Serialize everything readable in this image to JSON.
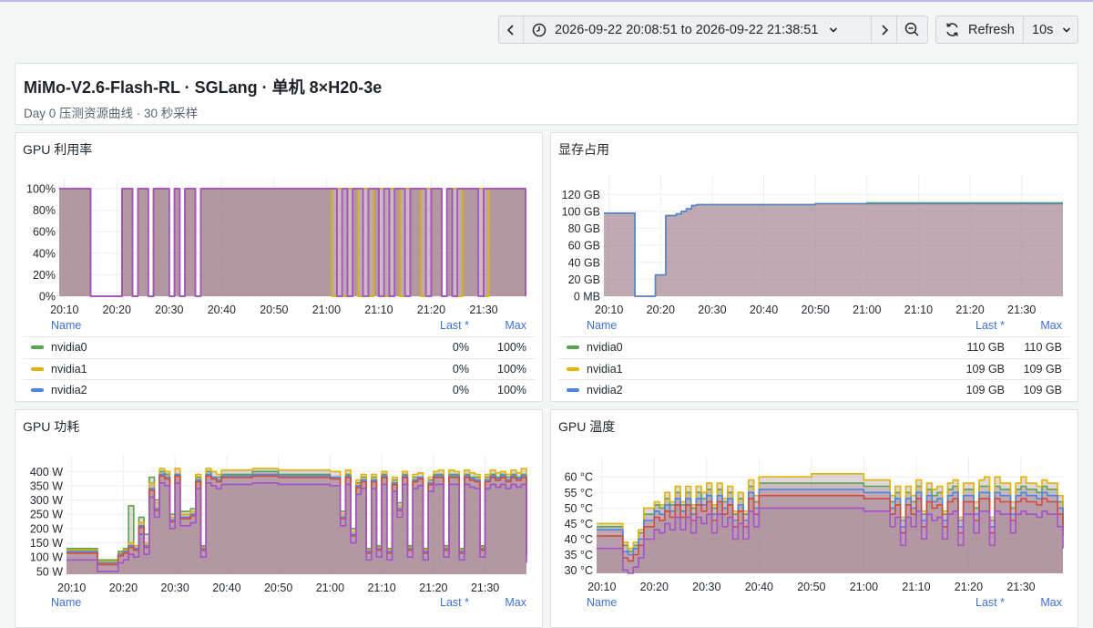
{
  "toolbar": {
    "time_range": "2026-09-22 20:08:51 to 2026-09-22 21:38:51",
    "refresh_label": "Refresh",
    "interval": "10s"
  },
  "header": {
    "title": "MiMo-V2.6-Flash-RL · SGLang · 单机 8×H20-3e",
    "subtitle": "Day 0 压测资源曲线 · 30 秒采样"
  },
  "colors": {
    "nvidia0": "#56a64b",
    "nvidia1": "#e0b400",
    "nvidia2": "#4d84e1",
    "red": "#d44a3a",
    "purple": "#a352cc",
    "fill": "#a88a94"
  },
  "panels": {
    "gpu_util": {
      "title": "GPU 利用率",
      "legend": {
        "name_header": "Name",
        "last_header": "Last *",
        "max_header": "Max",
        "rows": [
          {
            "name": "nvidia0",
            "last": "0%",
            "max": "100%"
          },
          {
            "name": "nvidia1",
            "last": "0%",
            "max": "100%"
          },
          {
            "name": "nvidia2",
            "last": "0%",
            "max": "100%"
          }
        ]
      }
    },
    "mem": {
      "title": "显存占用",
      "legend": {
        "name_header": "Name",
        "last_header": "Last *",
        "max_header": "Max",
        "rows": [
          {
            "name": "nvidia0",
            "last": "110 GB",
            "max": "110 GB"
          },
          {
            "name": "nvidia1",
            "last": "109 GB",
            "max": "109 GB"
          },
          {
            "name": "nvidia2",
            "last": "109 GB",
            "max": "109 GB"
          }
        ]
      }
    },
    "power": {
      "title": "GPU 功耗",
      "legend": {
        "name_header": "Name",
        "last_header": "Last *",
        "max_header": "Max"
      }
    },
    "temp": {
      "title": "GPU 温度",
      "legend": {
        "name_header": "Name",
        "last_header": "Last *",
        "max_header": "Max"
      }
    }
  },
  "chart_data": [
    {
      "id": "gpu_util",
      "type": "line",
      "title": "GPU 利用率",
      "x_ticks": [
        "20:10",
        "20:20",
        "20:30",
        "20:40",
        "20:50",
        "21:00",
        "21:10",
        "21:20",
        "21:30"
      ],
      "y_ticks": [
        "0%",
        "20%",
        "40%",
        "60%",
        "80%",
        "100%"
      ],
      "ylim": [
        0,
        100
      ],
      "x": [
        "20:09",
        "20:14",
        "20:15",
        "20:19",
        "20:20",
        "20:21",
        "20:22",
        "20:23",
        "20:24",
        "20:25",
        "20:26",
        "20:27",
        "20:28",
        "20:29",
        "20:30",
        "20:31",
        "20:32",
        "20:33",
        "20:34",
        "20:35",
        "20:36",
        "20:37",
        "20:38",
        "20:39",
        "21:00",
        "21:01",
        "21:02",
        "21:03",
        "21:04",
        "21:05",
        "21:06",
        "21:07",
        "21:08",
        "21:09",
        "21:10",
        "21:11",
        "21:12",
        "21:13",
        "21:14",
        "21:15",
        "21:16",
        "21:17",
        "21:18",
        "21:19",
        "21:20",
        "21:21",
        "21:22",
        "21:23",
        "21:24",
        "21:25",
        "21:26",
        "21:27",
        "21:28",
        "21:29",
        "21:30",
        "21:31",
        "21:32",
        "21:33",
        "21:34",
        "21:35",
        "21:36",
        "21:37",
        "21:38"
      ],
      "series": [
        {
          "name": "nvidia0",
          "values": [
            100,
            100,
            0,
            0,
            0,
            100,
            100,
            0,
            100,
            100,
            0,
            100,
            100,
            100,
            0,
            100,
            0,
            100,
            100,
            0,
            100,
            100,
            100,
            100,
            100,
            0,
            100,
            0,
            100,
            100,
            0,
            100,
            0,
            100,
            100,
            0,
            100,
            100,
            0,
            100,
            100,
            100,
            0,
            100,
            100,
            100,
            0,
            100,
            100,
            0,
            100,
            100,
            100,
            100,
            0,
            100,
            100,
            100,
            100,
            100,
            100,
            100,
            0
          ]
        },
        {
          "name": "nvidia1",
          "values": [
            100,
            100,
            0,
            0,
            0,
            100,
            100,
            0,
            100,
            100,
            0,
            100,
            100,
            100,
            0,
            100,
            0,
            100,
            100,
            0,
            100,
            100,
            100,
            100,
            100,
            0,
            100,
            0,
            100,
            100,
            0,
            100,
            0,
            100,
            100,
            0,
            100,
            100,
            0,
            100,
            100,
            100,
            0,
            100,
            100,
            100,
            0,
            100,
            100,
            0,
            100,
            100,
            100,
            100,
            0,
            100,
            100,
            100,
            100,
            100,
            100,
            100,
            0
          ]
        },
        {
          "name": "nvidia2",
          "values": [
            100,
            100,
            0,
            0,
            0,
            100,
            100,
            0,
            100,
            100,
            0,
            100,
            100,
            100,
            0,
            100,
            0,
            100,
            100,
            0,
            100,
            100,
            100,
            100,
            100,
            100,
            0,
            100,
            0,
            100,
            100,
            0,
            100,
            100,
            0,
            100,
            0,
            100,
            100,
            0,
            100,
            100,
            100,
            0,
            100,
            100,
            0,
            100,
            0,
            100,
            100,
            100,
            100,
            0,
            100,
            100,
            100,
            100,
            100,
            100,
            100,
            100,
            0
          ]
        }
      ]
    },
    {
      "id": "mem",
      "type": "line",
      "title": "显存占用",
      "x_ticks": [
        "20:10",
        "20:20",
        "20:30",
        "20:40",
        "20:50",
        "21:00",
        "21:10",
        "21:20",
        "21:30"
      ],
      "y_ticks": [
        "0 MB",
        "20 GB",
        "40 GB",
        "60 GB",
        "80 GB",
        "100 GB",
        "120 GB"
      ],
      "ylim": [
        0,
        130
      ],
      "x": [
        "20:09",
        "20:14",
        "20:15",
        "20:18",
        "20:19",
        "20:20",
        "20:21",
        "20:22",
        "20:23",
        "20:24",
        "20:25",
        "20:26",
        "20:27",
        "20:30",
        "20:40",
        "20:50",
        "21:00",
        "21:10",
        "21:20",
        "21:30",
        "21:38"
      ],
      "series": [
        {
          "name": "nvidia0",
          "values": [
            98,
            98,
            0,
            0,
            25,
            25,
            95,
            95,
            97,
            100,
            103,
            107,
            108,
            108,
            108,
            109,
            110,
            110,
            110,
            110,
            110
          ]
        },
        {
          "name": "nvidia1",
          "values": [
            98,
            98,
            0,
            0,
            25,
            25,
            95,
            95,
            97,
            100,
            103,
            107,
            108,
            108,
            108,
            109,
            109,
            109,
            109,
            109,
            109
          ]
        },
        {
          "name": "nvidia2",
          "values": [
            98,
            98,
            0,
            0,
            25,
            25,
            95,
            95,
            97,
            100,
            103,
            107,
            108,
            108,
            108,
            109,
            109,
            109,
            109,
            109,
            109
          ]
        }
      ]
    },
    {
      "id": "power",
      "type": "line",
      "title": "GPU 功耗",
      "x_ticks": [
        "20:10",
        "20:20",
        "20:30",
        "20:40",
        "20:50",
        "21:00",
        "21:10",
        "21:20",
        "21:30"
      ],
      "y_ticks": [
        "50 W",
        "100 W",
        "150 W",
        "200 W",
        "250 W",
        "300 W",
        "350 W",
        "400 W"
      ],
      "ylim": [
        40,
        420
      ],
      "x": [
        "20:09",
        "20:14",
        "20:15",
        "20:18",
        "20:19",
        "20:20",
        "20:21",
        "20:22",
        "20:23",
        "20:24",
        "20:25",
        "20:26",
        "20:27",
        "20:28",
        "20:29",
        "20:30",
        "20:31",
        "20:32",
        "20:33",
        "20:34",
        "20:35",
        "20:36",
        "20:37",
        "20:38",
        "20:39",
        "20:40",
        "20:45",
        "20:50",
        "20:55",
        "21:00",
        "21:02",
        "21:03",
        "21:04",
        "21:05",
        "21:06",
        "21:07",
        "21:08",
        "21:09",
        "21:10",
        "21:11",
        "21:12",
        "21:13",
        "21:14",
        "21:15",
        "21:16",
        "21:17",
        "21:18",
        "21:19",
        "21:20",
        "21:21",
        "21:22",
        "21:23",
        "21:24",
        "21:25",
        "21:26",
        "21:27",
        "21:28",
        "21:29",
        "21:30",
        "21:31",
        "21:32",
        "21:33",
        "21:34",
        "21:35",
        "21:36",
        "21:37",
        "21:38"
      ],
      "series": [
        {
          "name": "nvidia0",
          "values": [
            130,
            130,
            90,
            90,
            120,
            130,
            280,
            140,
            240,
            180,
            380,
            300,
            400,
            390,
            250,
            390,
            260,
            260,
            270,
            380,
            140,
            400,
            380,
            380,
            390,
            390,
            400,
            390,
            390,
            380,
            260,
            390,
            200,
            360,
            380,
            130,
            380,
            140,
            390,
            130,
            370,
            290,
            390,
            140,
            380,
            380,
            130,
            370,
            390,
            390,
            140,
            390,
            390,
            130,
            390,
            380,
            380,
            140,
            380,
            390,
            380,
            390,
            380,
            390,
            380,
            390,
            120
          ]
        },
        {
          "name": "nvidia1",
          "values": [
            125,
            125,
            85,
            85,
            115,
            125,
            150,
            140,
            220,
            150,
            360,
            290,
            410,
            400,
            240,
            410,
            250,
            250,
            260,
            390,
            135,
            410,
            400,
            390,
            405,
            405,
            410,
            405,
            405,
            400,
            250,
            405,
            190,
            370,
            390,
            125,
            390,
            135,
            400,
            125,
            380,
            280,
            400,
            135,
            390,
            395,
            125,
            380,
            400,
            405,
            135,
            405,
            400,
            125,
            405,
            395,
            390,
            135,
            390,
            405,
            395,
            400,
            390,
            405,
            395,
            410,
            115
          ]
        },
        {
          "name": "nvidia2",
          "values": [
            120,
            120,
            80,
            80,
            110,
            120,
            140,
            130,
            210,
            140,
            340,
            270,
            390,
            380,
            230,
            390,
            240,
            240,
            250,
            370,
            130,
            390,
            380,
            370,
            385,
            385,
            390,
            385,
            385,
            380,
            240,
            385,
            180,
            350,
            370,
            120,
            370,
            130,
            385,
            120,
            360,
            270,
            385,
            130,
            370,
            380,
            120,
            360,
            385,
            385,
            130,
            385,
            385,
            120,
            385,
            375,
            370,
            130,
            370,
            385,
            375,
            385,
            370,
            385,
            375,
            385,
            110
          ]
        }
      ]
    },
    {
      "id": "temp",
      "type": "line",
      "title": "GPU 温度",
      "x_ticks": [
        "20:10",
        "20:20",
        "20:30",
        "20:40",
        "20:50",
        "21:00",
        "21:10",
        "21:20",
        "21:30"
      ],
      "y_ticks": [
        "30 °C",
        "35 °C",
        "40 °C",
        "45 °C",
        "50 °C",
        "55 °C",
        "60 °C"
      ],
      "ylim": [
        29,
        63
      ],
      "x": [
        "20:09",
        "20:13",
        "20:14",
        "20:15",
        "20:16",
        "20:17",
        "20:18",
        "20:19",
        "20:20",
        "20:21",
        "20:22",
        "20:23",
        "20:24",
        "20:25",
        "20:26",
        "20:27",
        "20:28",
        "20:29",
        "20:30",
        "20:31",
        "20:32",
        "20:33",
        "20:34",
        "20:35",
        "20:36",
        "20:37",
        "20:38",
        "20:39",
        "20:40",
        "20:45",
        "20:50",
        "20:55",
        "21:00",
        "21:04",
        "21:05",
        "21:06",
        "21:07",
        "21:08",
        "21:09",
        "21:10",
        "21:11",
        "21:12",
        "21:13",
        "21:14",
        "21:15",
        "21:16",
        "21:17",
        "21:18",
        "21:19",
        "21:20",
        "21:21",
        "21:22",
        "21:23",
        "21:24",
        "21:25",
        "21:26",
        "21:27",
        "21:28",
        "21:29",
        "21:30",
        "21:31",
        "21:32",
        "21:33",
        "21:34",
        "21:35",
        "21:36",
        "21:37",
        "21:38"
      ],
      "series": [
        {
          "name": "nvidia0",
          "values": [
            44,
            44,
            38,
            36,
            38,
            42,
            48,
            48,
            51,
            50,
            53,
            51,
            55,
            51,
            55,
            50,
            55,
            53,
            56,
            50,
            56,
            52,
            55,
            48,
            53,
            48,
            57,
            52,
            58,
            58,
            58,
            58,
            57,
            57,
            52,
            55,
            46,
            55,
            52,
            57,
            48,
            56,
            54,
            55,
            48,
            56,
            57,
            46,
            56,
            56,
            50,
            57,
            57,
            46,
            57,
            56,
            56,
            50,
            56,
            57,
            56,
            56,
            55,
            57,
            56,
            56,
            52,
            45
          ]
        },
        {
          "name": "nvidia1",
          "values": [
            45,
            45,
            39,
            37,
            39,
            43,
            50,
            50,
            52,
            51,
            55,
            52,
            57,
            52,
            57,
            51,
            57,
            55,
            58,
            51,
            58,
            53,
            57,
            49,
            55,
            49,
            59,
            54,
            60,
            60,
            61,
            61,
            59,
            59,
            54,
            57,
            47,
            57,
            54,
            59,
            49,
            58,
            56,
            57,
            49,
            58,
            59,
            47,
            58,
            58,
            52,
            59,
            60,
            47,
            60,
            58,
            58,
            52,
            58,
            60,
            58,
            58,
            57,
            59,
            58,
            58,
            54,
            46
          ]
        },
        {
          "name": "nvidia2",
          "values": [
            43,
            43,
            36,
            35,
            37,
            40,
            46,
            46,
            49,
            48,
            51,
            49,
            53,
            49,
            53,
            48,
            53,
            51,
            54,
            48,
            54,
            50,
            53,
            46,
            51,
            46,
            55,
            50,
            56,
            56,
            56,
            56,
            55,
            55,
            50,
            53,
            44,
            53,
            50,
            55,
            46,
            54,
            52,
            53,
            46,
            54,
            55,
            44,
            54,
            54,
            48,
            55,
            55,
            44,
            55,
            54,
            54,
            48,
            54,
            55,
            54,
            54,
            53,
            55,
            54,
            54,
            50,
            43
          ]
        }
      ]
    }
  ]
}
